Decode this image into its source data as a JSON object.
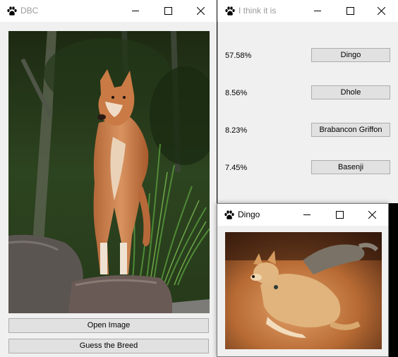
{
  "main_window": {
    "title": "DBC",
    "open_image_label": "Open Image",
    "guess_breed_label": "Guess the Breed"
  },
  "results_window": {
    "title": "I think it is",
    "results": [
      {
        "percent": "57.58%",
        "breed": "Dingo"
      },
      {
        "percent": "8.56%",
        "breed": "Dhole"
      },
      {
        "percent": "8.23%",
        "breed": "Brabancon Griffon"
      },
      {
        "percent": "7.45%",
        "breed": "Basenji"
      }
    ]
  },
  "breed_window": {
    "title": "Dingo"
  },
  "icons": {
    "app": "paw-icon",
    "minimize": "minimize-icon",
    "maximize": "maximize-icon",
    "close": "close-icon"
  }
}
